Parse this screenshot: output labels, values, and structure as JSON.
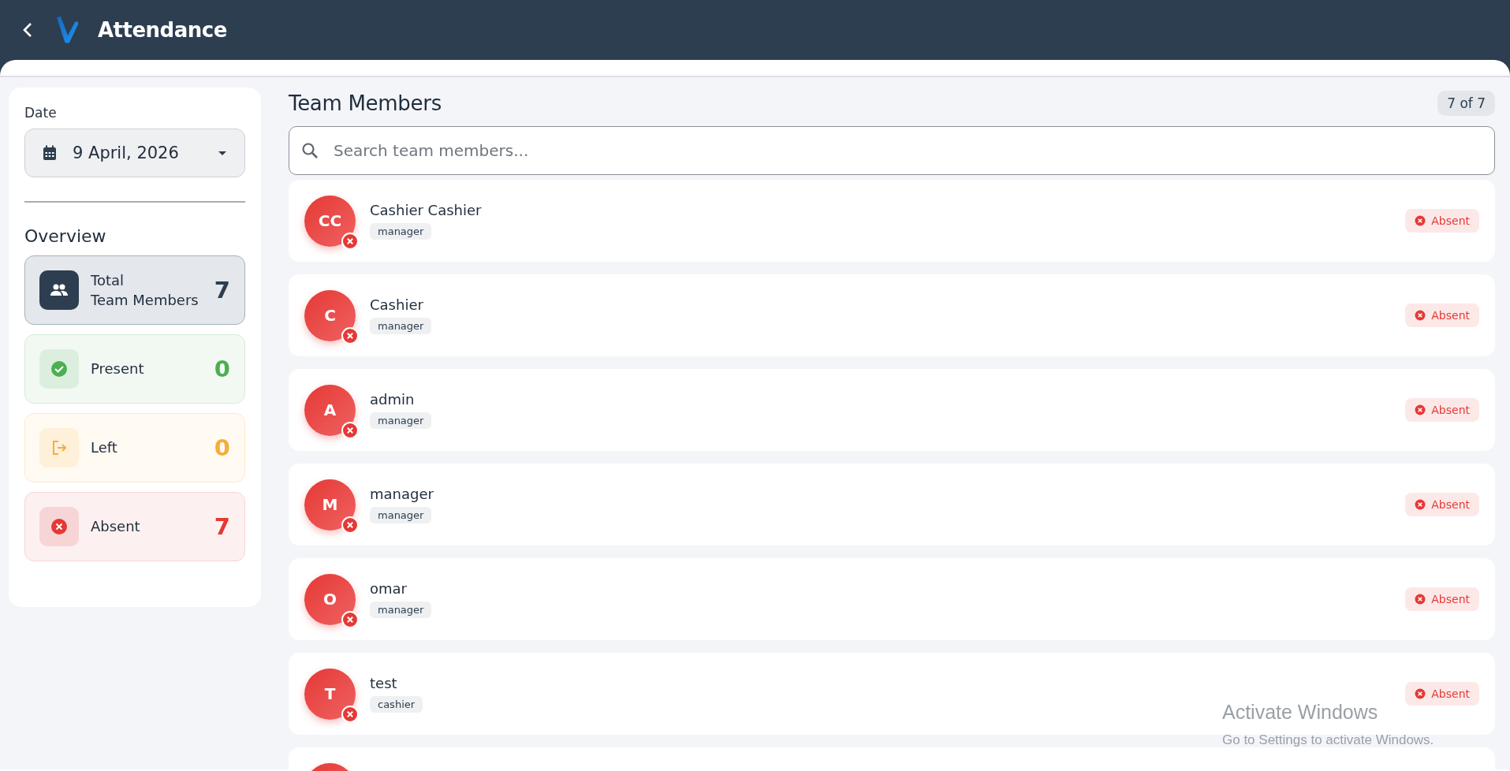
{
  "header": {
    "title": "Attendance"
  },
  "sidebar": {
    "date_label": "Date",
    "date_value": "9 April, 2026",
    "overview_title": "Overview",
    "stats": [
      {
        "kind": "total",
        "label": "Total",
        "sublabel": "Team Members",
        "count": "7",
        "selected": true
      },
      {
        "kind": "present",
        "label": "Present",
        "count": "0",
        "selected": false
      },
      {
        "kind": "left",
        "label": "Left",
        "count": "0",
        "selected": false
      },
      {
        "kind": "absent",
        "label": "Absent",
        "count": "7",
        "selected": false
      }
    ]
  },
  "main": {
    "title": "Team Members",
    "count_badge": "7 of 7",
    "search": {
      "placeholder": "Search team members..."
    },
    "members": [
      {
        "initials": "CC",
        "name": "Cashier Cashier",
        "role": "manager",
        "kind": "absent",
        "status": "Absent"
      },
      {
        "initials": "C",
        "name": "Cashier",
        "role": "manager",
        "kind": "absent",
        "status": "Absent"
      },
      {
        "initials": "A",
        "name": "admin",
        "role": "manager",
        "kind": "absent",
        "status": "Absent"
      },
      {
        "initials": "M",
        "name": "manager",
        "role": "manager",
        "kind": "absent",
        "status": "Absent"
      },
      {
        "initials": "O",
        "name": "omar",
        "role": "manager",
        "kind": "absent",
        "status": "Absent"
      },
      {
        "initials": "T",
        "name": "test",
        "role": "cashier",
        "kind": "absent",
        "status": "Absent"
      }
    ]
  },
  "os_overlay": {
    "title": "Activate Windows",
    "subtitle": "Go to Settings to activate Windows."
  }
}
